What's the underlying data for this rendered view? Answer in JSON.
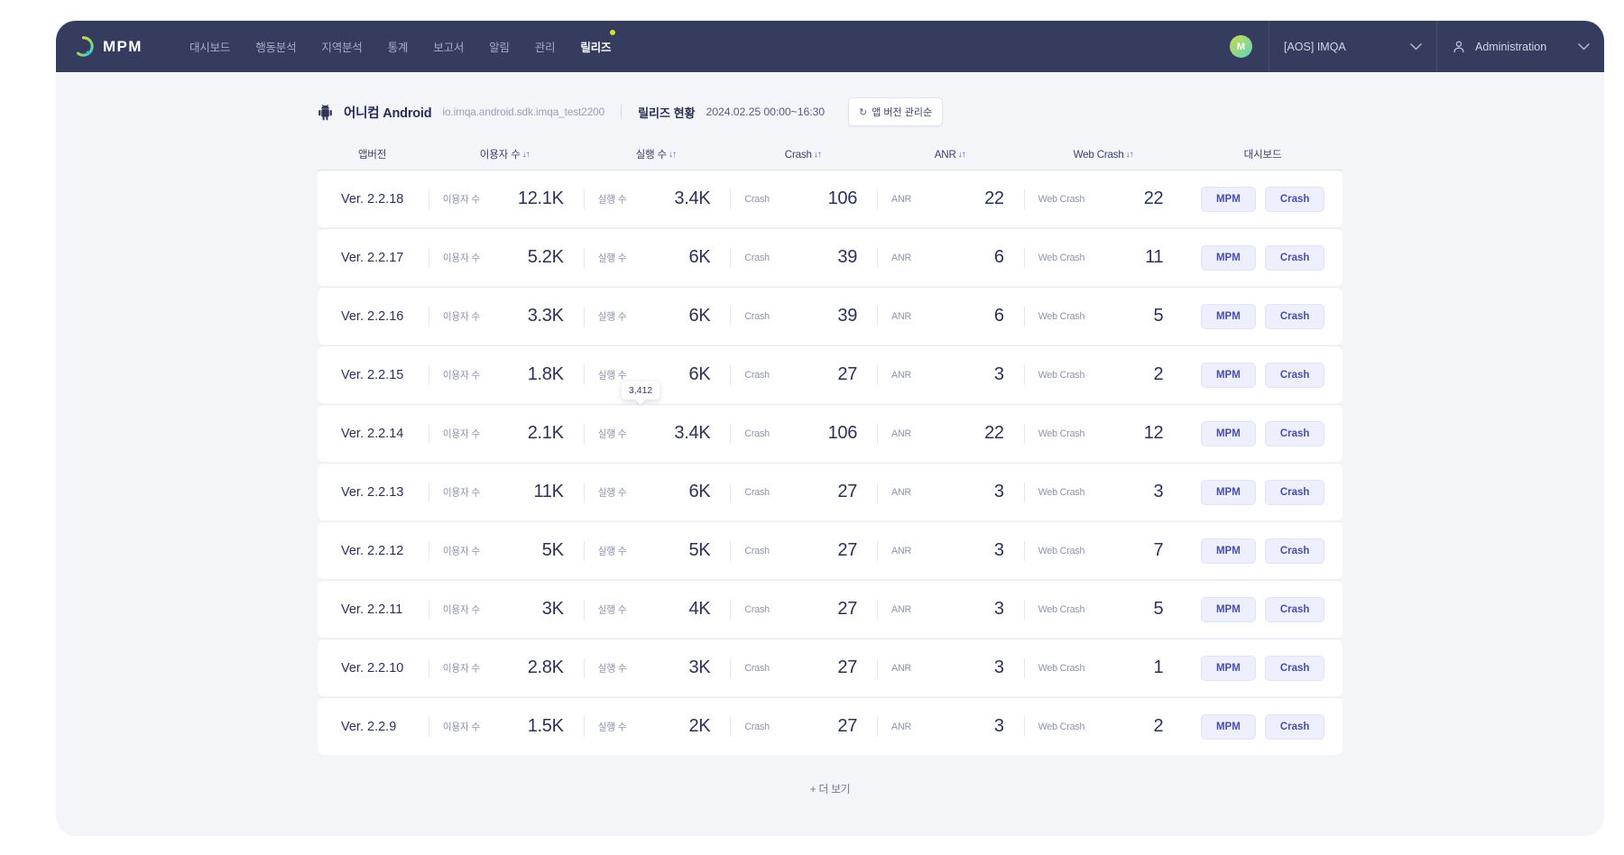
{
  "header": {
    "brand": "MPM",
    "logo_icon": "mpm-logo-icon",
    "nav": [
      {
        "label": "대시보드",
        "active": false,
        "dot": false
      },
      {
        "label": "행동분석",
        "active": false,
        "dot": false
      },
      {
        "label": "지역분석",
        "active": false,
        "dot": false
      },
      {
        "label": "통계",
        "active": false,
        "dot": false
      },
      {
        "label": "보고서",
        "active": false,
        "dot": false
      },
      {
        "label": "알림",
        "active": false,
        "dot": false
      },
      {
        "label": "관리",
        "active": false,
        "dot": false
      },
      {
        "label": "릴리즈",
        "active": true,
        "dot": true
      }
    ],
    "avatar_initial": "M",
    "project_select": "[AOS] IMQA",
    "account_select": "Administration",
    "chevron_icon": "chevron-down-icon",
    "person_icon": "person-icon",
    "accent_dot_color": "#d4e02a",
    "bar_color": "#353c5e"
  },
  "appbar": {
    "platform_icon": "android-icon",
    "app_name": "어니컴 Android",
    "package": "io.imqa.android.sdk.imqa_test2200",
    "release_label": "릴리즈 현황",
    "date_range": "2024.02.25 00:00~16:30",
    "sort_button": "앱 버전 관리순",
    "sort_button_icon": "refresh-icon"
  },
  "table": {
    "columns": [
      {
        "key": "version",
        "label": "앱버전",
        "sortable": false
      },
      {
        "key": "users",
        "label": "이용자 수",
        "sortable": true
      },
      {
        "key": "runs",
        "label": "실행 수",
        "sortable": true
      },
      {
        "key": "crash",
        "label": "Crash",
        "sortable": true
      },
      {
        "key": "anr",
        "label": "ANR",
        "sortable": true
      },
      {
        "key": "webcrash",
        "label": "Web Crash",
        "sortable": true
      },
      {
        "key": "dashboard",
        "label": "대시보드",
        "sortable": false
      }
    ],
    "sort_icon": "↓↑",
    "inline_labels": {
      "users": "이용자 수",
      "runs": "실행 수",
      "crash": "Crash",
      "anr": "ANR",
      "webcrash": "Web Crash"
    },
    "actions": {
      "mpm": "MPM",
      "crash": "Crash"
    },
    "rows": [
      {
        "version": "Ver. 2.2.18",
        "users": "12.1K",
        "runs": "3.4K",
        "crash": "106",
        "anr": "22",
        "webcrash": "22"
      },
      {
        "version": "Ver. 2.2.17",
        "users": "5.2K",
        "runs": "6K",
        "crash": "39",
        "anr": "6",
        "webcrash": "11"
      },
      {
        "version": "Ver. 2.2.16",
        "users": "3.3K",
        "runs": "6K",
        "crash": "39",
        "anr": "6",
        "webcrash": "5"
      },
      {
        "version": "Ver. 2.2.15",
        "users": "1.8K",
        "runs": "6K",
        "crash": "27",
        "anr": "3",
        "webcrash": "2"
      },
      {
        "version": "Ver. 2.2.14",
        "users": "2.1K",
        "runs": "3.4K",
        "crash": "106",
        "anr": "22",
        "webcrash": "12",
        "runs_tooltip": "3,412"
      },
      {
        "version": "Ver. 2.2.13",
        "users": "11K",
        "runs": "6K",
        "crash": "27",
        "anr": "3",
        "webcrash": "3"
      },
      {
        "version": "Ver. 2.2.12",
        "users": "5K",
        "runs": "5K",
        "crash": "27",
        "anr": "3",
        "webcrash": "7"
      },
      {
        "version": "Ver. 2.2.11",
        "users": "3K",
        "runs": "4K",
        "crash": "27",
        "anr": "3",
        "webcrash": "5"
      },
      {
        "version": "Ver. 2.2.10",
        "users": "2.8K",
        "runs": "3K",
        "crash": "27",
        "anr": "3",
        "webcrash": "1"
      },
      {
        "version": "Ver. 2.2.9",
        "users": "1.5K",
        "runs": "2K",
        "crash": "27",
        "anr": "3",
        "webcrash": "2"
      }
    ],
    "more_label": "+ 더 보기"
  }
}
